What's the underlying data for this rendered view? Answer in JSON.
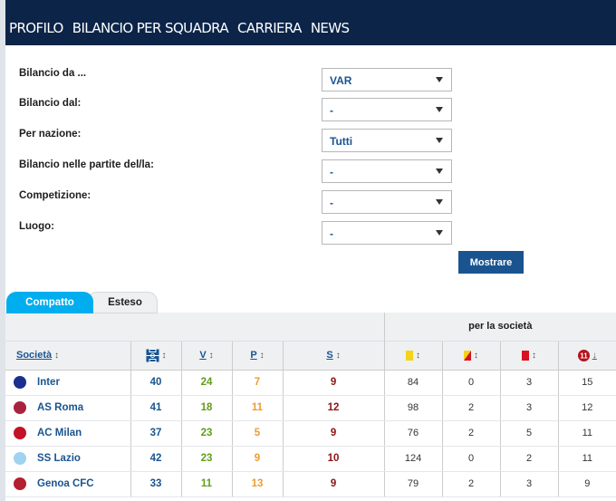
{
  "nav": {
    "items": [
      "Profilo",
      "Bilancio per squadra",
      "Carriera",
      "News"
    ]
  },
  "form": {
    "rows": [
      {
        "label": "Bilancio da ...",
        "value": "VAR"
      },
      {
        "label": "Bilancio dal:",
        "value": "-"
      },
      {
        "label": "Per nazione:",
        "value": "Tutti"
      },
      {
        "label": "Bilancio nelle partite del/la:",
        "value": "-"
      },
      {
        "label": "Competizione:",
        "value": "-"
      },
      {
        "label": "Luogo:",
        "value": "-"
      }
    ],
    "submit_label": "Mostrare"
  },
  "tabs": {
    "active": "Compatto",
    "inactive": "Esteso"
  },
  "table": {
    "group_label": "per la società",
    "col_club": "Società",
    "col_v": "V",
    "col_p": "P",
    "col_s": "S",
    "sort_glyph": "↕",
    "sort_active_glyph": "↓",
    "icons": {
      "games": "pitch-icon",
      "yellow": "yellow-card-icon",
      "yellow_red": "yellow-red-card-icon",
      "red": "red-card-icon",
      "penalty": "penalty-icon"
    },
    "colors": {
      "games": "#1a5490",
      "wins": "#5f9e1a",
      "draws": "#ee9b33",
      "losses": "#8b1414",
      "yellow": "#f4d31a",
      "red": "#d9121f",
      "header_bg": "#0c2448",
      "tab_active": "#00aeef"
    },
    "rows": [
      {
        "club": "Inter",
        "logo_color": "#1b2f8f",
        "g": "40",
        "v": "24",
        "p": "7",
        "s": "9",
        "yc": "84",
        "yrc": "0",
        "rc": "3",
        "pen": "15"
      },
      {
        "club": "AS Roma",
        "logo_color": "#a8233f",
        "g": "41",
        "v": "18",
        "p": "11",
        "s": "12",
        "yc": "98",
        "yrc": "2",
        "rc": "3",
        "pen": "12"
      },
      {
        "club": "AC Milan",
        "logo_color": "#c21426",
        "g": "37",
        "v": "23",
        "p": "5",
        "s": "9",
        "yc": "76",
        "yrc": "2",
        "rc": "5",
        "pen": "11"
      },
      {
        "club": "SS Lazio",
        "logo_color": "#9fd3ef",
        "g": "42",
        "v": "23",
        "p": "9",
        "s": "10",
        "yc": "124",
        "yrc": "0",
        "rc": "2",
        "pen": "11"
      },
      {
        "club": "Genoa CFC",
        "logo_color": "#b4202f",
        "g": "33",
        "v": "11",
        "p": "13",
        "s": "9",
        "yc": "79",
        "yrc": "2",
        "rc": "3",
        "pen": "9"
      }
    ]
  }
}
